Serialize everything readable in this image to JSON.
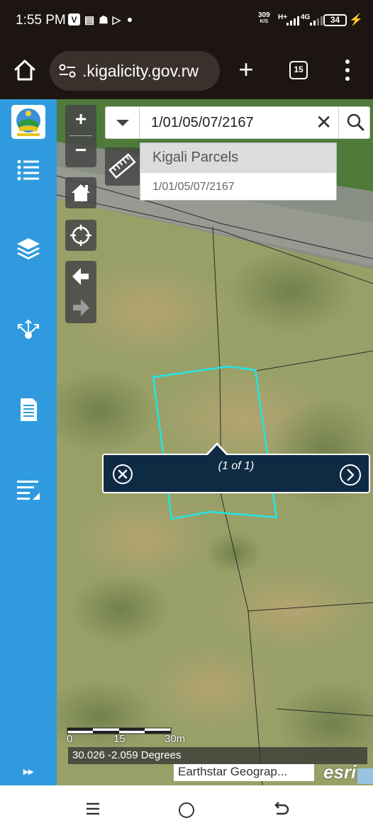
{
  "status_bar": {
    "time": "1:55 PM",
    "app_icons": [
      "V",
      "message-icon",
      "android-icon",
      "play-icon"
    ],
    "net_speed_value": "309",
    "net_speed_unit": "K/S",
    "network_type_1": "H+",
    "network_type_2": "4G",
    "battery": "34"
  },
  "browser": {
    "url_prefix": "",
    "url": ".kigalicity.gov.rw",
    "tab_count": "15"
  },
  "map": {
    "search_value": "1/01/05/07/2167",
    "suggestions": {
      "header": "Kigali Parcels",
      "item": "1/01/05/07/2167"
    },
    "popup": {
      "title": "(1 of 1)"
    },
    "scale": {
      "labels": [
        "0",
        "15",
        "30m"
      ]
    },
    "coordinates": "30.026 -2.059 Degrees",
    "attribution": "Earthstar Geograp...",
    "provider": "esri",
    "parcel_color": "#22e5e5",
    "sidebar_color": "#2f9bde",
    "sidebar_expand": "▸▸"
  },
  "sidebar": {
    "icons": [
      "logo",
      "list-icon",
      "layers-icon",
      "network-icon",
      "document-icon",
      "edit-list-icon"
    ]
  }
}
